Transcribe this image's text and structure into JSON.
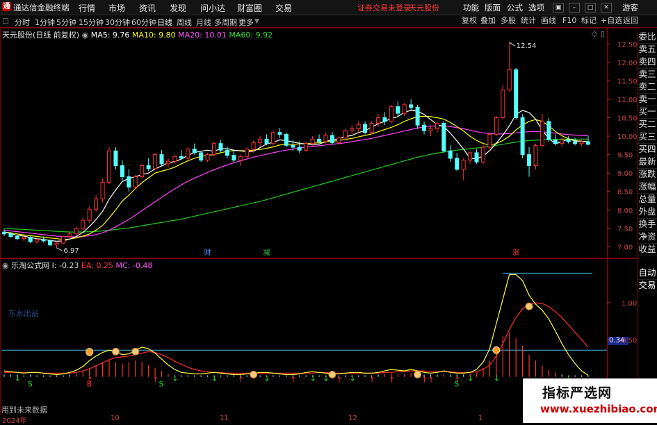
{
  "titlebar": {
    "app_title": "通达信金融终端",
    "menus": [
      "行情",
      "市场",
      "资讯",
      "发现",
      "问小达",
      "财富圈",
      "交易"
    ],
    "status_text": "证券交易未登录",
    "stock_name": "天元股份",
    "right_menus": [
      "功能",
      "版面",
      "公式",
      "选项"
    ],
    "guest": "游客"
  },
  "toolbar": {
    "periods": [
      "分时",
      "1分钟",
      "5分钟",
      "15分钟",
      "30分钟",
      "60分钟",
      "日线",
      "周线",
      "月线",
      "多周期",
      "更多"
    ],
    "active_period": "日线",
    "buttons": [
      "复权",
      "叠加",
      "多股",
      "统计",
      "画线",
      "F10",
      "标记",
      "+自选",
      "返回"
    ]
  },
  "main_chart": {
    "title": "天元股份(日线 前复权)",
    "ma_legend": [
      {
        "label": "MA5: 9.76",
        "color": "#ffffff"
      },
      {
        "label": "MA10: 9.80",
        "color": "#ffff00"
      },
      {
        "label": "MA20: 10.01",
        "color": "#ff55ff"
      },
      {
        "label": "MA60: 9.92",
        "color": "#33dd33"
      }
    ],
    "high_label": "12.54",
    "low_label": "6.97",
    "markers": [
      {
        "text": "财",
        "color": "#4a8cff"
      },
      {
        "text": "减",
        "color": "#33cc33"
      },
      {
        "text": "涨",
        "color": "#ff3333"
      }
    ]
  },
  "indicator": {
    "title": "乐淘公式网",
    "values": [
      {
        "label": "I: -0.23",
        "color": "#dddddd"
      },
      {
        "label": "EA: 0.25",
        "color": "#ff3333"
      },
      {
        "label": "MC: -0.48",
        "color": "#ff55ff"
      }
    ],
    "watermark_text": "东水出品",
    "current_value": "0.34",
    "footer_note": "用到未来数据",
    "signal_letters": [
      "S",
      "B",
      "S",
      "S"
    ]
  },
  "xaxis": {
    "labels": [
      "2024年",
      "10",
      "11",
      "12",
      "1"
    ]
  },
  "right_panel": {
    "items": [
      "委比",
      "卖五",
      "卖四",
      "卖三",
      "卖二",
      "卖一",
      "买一",
      "买二",
      "买三",
      "买四",
      "最新",
      "涨跌",
      "涨幅",
      "总量",
      "外盘",
      "换手",
      "净资",
      "收益"
    ],
    "bottom_items": [
      "自动",
      "交易"
    ]
  },
  "watermark": {
    "title": "指标严选网",
    "url": "www.xuezhibiao.com"
  },
  "chart_data": {
    "type": "candlestick",
    "ylabels": [
      "12.50",
      "12.00",
      "11.50",
      "11.00",
      "10.50",
      "10.00",
      "9.50",
      "9.00",
      "8.50",
      "8.00",
      "7.50",
      "7.00"
    ],
    "ylim": [
      6.8,
      12.6
    ],
    "indicator_ylabels": [
      "1.00",
      "0.50"
    ],
    "indicator_ylim": [
      -0.05,
      1.45
    ],
    "candles": [
      [
        7.4,
        7.48,
        7.3,
        7.35
      ],
      [
        7.35,
        7.4,
        7.25,
        7.28
      ],
      [
        7.28,
        7.32,
        7.18,
        7.22
      ],
      [
        7.22,
        7.3,
        7.15,
        7.26
      ],
      [
        7.26,
        7.3,
        7.1,
        7.14
      ],
      [
        7.14,
        7.25,
        7.08,
        7.2
      ],
      [
        7.2,
        7.28,
        7.12,
        7.16
      ],
      [
        7.16,
        7.2,
        7.02,
        7.05
      ],
      [
        7.05,
        7.15,
        6.97,
        7.1
      ],
      [
        7.1,
        7.3,
        7.08,
        7.28
      ],
      [
        7.28,
        7.42,
        7.22,
        7.35
      ],
      [
        7.35,
        7.55,
        7.3,
        7.5
      ],
      [
        7.5,
        7.8,
        7.45,
        7.72
      ],
      [
        7.72,
        8.1,
        7.65,
        8.02
      ],
      [
        8.02,
        8.4,
        7.95,
        8.3
      ],
      [
        8.3,
        8.85,
        8.2,
        8.75
      ],
      [
        8.75,
        9.7,
        8.7,
        9.6
      ],
      [
        9.6,
        9.7,
        9.1,
        9.2
      ],
      [
        9.2,
        9.35,
        8.8,
        8.9
      ],
      [
        8.9,
        9.1,
        8.5,
        8.62
      ],
      [
        8.62,
        8.95,
        8.55,
        8.9
      ],
      [
        8.9,
        9.25,
        8.85,
        9.2
      ],
      [
        9.2,
        9.4,
        9.05,
        9.12
      ],
      [
        9.12,
        9.55,
        9.1,
        9.5
      ],
      [
        9.5,
        9.62,
        9.2,
        9.25
      ],
      [
        9.25,
        9.4,
        9.15,
        9.32
      ],
      [
        9.32,
        9.5,
        9.25,
        9.45
      ],
      [
        9.45,
        9.62,
        9.35,
        9.4
      ],
      [
        9.4,
        9.7,
        9.35,
        9.65
      ],
      [
        9.65,
        9.8,
        9.5,
        9.55
      ],
      [
        9.55,
        9.6,
        9.3,
        9.35
      ],
      [
        9.35,
        9.55,
        9.3,
        9.5
      ],
      [
        9.5,
        9.85,
        9.45,
        9.8
      ],
      [
        9.8,
        9.9,
        9.55,
        9.62
      ],
      [
        9.62,
        9.72,
        9.4,
        9.48
      ],
      [
        9.48,
        9.6,
        9.3,
        9.35
      ],
      [
        9.35,
        9.5,
        9.2,
        9.45
      ],
      [
        9.45,
        9.7,
        9.4,
        9.65
      ],
      [
        9.65,
        9.88,
        9.55,
        9.82
      ],
      [
        9.82,
        10.0,
        9.7,
        9.92
      ],
      [
        9.92,
        10.05,
        9.75,
        9.8
      ],
      [
        9.8,
        10.15,
        9.75,
        10.1
      ],
      [
        10.1,
        10.22,
        9.95,
        10.05
      ],
      [
        10.05,
        10.1,
        9.7,
        9.75
      ],
      [
        9.75,
        9.9,
        9.6,
        9.7
      ],
      [
        9.7,
        9.85,
        9.55,
        9.62
      ],
      [
        9.62,
        9.85,
        9.58,
        9.8
      ],
      [
        9.8,
        10.0,
        9.72,
        9.92
      ],
      [
        9.92,
        10.05,
        9.8,
        9.85
      ],
      [
        9.85,
        10.1,
        9.8,
        10.02
      ],
      [
        10.02,
        10.12,
        9.78,
        9.82
      ],
      [
        9.82,
        10.0,
        9.78,
        9.95
      ],
      [
        9.95,
        10.2,
        9.9,
        10.15
      ],
      [
        10.15,
        10.3,
        10.05,
        10.2
      ],
      [
        10.2,
        10.4,
        10.1,
        10.32
      ],
      [
        10.32,
        10.4,
        10.05,
        10.1
      ],
      [
        10.1,
        10.4,
        10.05,
        10.35
      ],
      [
        10.35,
        10.6,
        10.25,
        10.5
      ],
      [
        10.5,
        10.65,
        10.3,
        10.4
      ],
      [
        10.4,
        10.85,
        10.35,
        10.8
      ],
      [
        10.8,
        10.95,
        10.55,
        10.62
      ],
      [
        10.62,
        10.9,
        10.55,
        10.85
      ],
      [
        10.85,
        11.0,
        10.7,
        10.78
      ],
      [
        10.78,
        10.85,
        10.2,
        10.3
      ],
      [
        10.3,
        10.4,
        10.05,
        10.15
      ],
      [
        10.15,
        10.3,
        10.0,
        10.2
      ],
      [
        10.2,
        10.4,
        10.1,
        10.35
      ],
      [
        10.35,
        10.4,
        9.55,
        9.6
      ],
      [
        9.6,
        9.75,
        9.3,
        9.4
      ],
      [
        9.4,
        9.55,
        9.05,
        9.1
      ],
      [
        9.1,
        9.4,
        8.8,
        9.35
      ],
      [
        9.35,
        9.6,
        9.25,
        9.55
      ],
      [
        9.55,
        9.65,
        9.25,
        9.3
      ],
      [
        9.3,
        9.75,
        9.25,
        9.7
      ],
      [
        9.7,
        10.1,
        9.65,
        10.05
      ],
      [
        10.05,
        10.55,
        10.0,
        10.5
      ],
      [
        10.5,
        11.4,
        10.45,
        11.25
      ],
      [
        11.25,
        12.54,
        11.2,
        11.8
      ],
      [
        11.8,
        11.85,
        10.45,
        10.5
      ],
      [
        10.5,
        10.6,
        9.4,
        9.5
      ],
      [
        9.5,
        9.7,
        8.9,
        9.2
      ],
      [
        9.2,
        9.8,
        9.1,
        9.75
      ],
      [
        9.75,
        10.6,
        9.7,
        10.4
      ],
      [
        10.4,
        10.5,
        9.85,
        9.9
      ],
      [
        9.9,
        10.05,
        9.75,
        9.8
      ],
      [
        9.8,
        9.95,
        9.7,
        9.9
      ],
      [
        9.9,
        10.0,
        9.8,
        9.85
      ],
      [
        9.85,
        9.95,
        9.75,
        9.8
      ],
      [
        9.8,
        9.92,
        9.72,
        9.85
      ],
      [
        9.85,
        10.0,
        9.75,
        9.78
      ]
    ],
    "ma5": [
      7.4,
      7.36,
      7.31,
      7.29,
      7.25,
      7.22,
      7.2,
      7.17,
      7.15,
      7.16,
      7.21,
      7.28,
      7.39,
      7.55,
      7.74,
      7.96,
      8.29,
      8.54,
      8.77,
      8.85,
      8.9,
      8.96,
      9.0,
      9.11,
      9.19,
      9.28,
      9.31,
      9.38,
      9.48,
      9.56,
      9.59,
      9.62,
      9.59,
      9.66,
      9.66,
      9.62,
      9.6,
      9.58,
      9.59,
      9.69,
      9.79,
      9.83,
      9.9,
      9.88,
      9.84,
      9.81,
      9.78,
      9.77,
      9.78,
      9.86,
      9.9,
      9.93,
      9.99,
      10.02,
      10.1,
      10.15,
      10.24,
      10.34,
      10.4,
      10.48,
      10.53,
      10.65,
      10.7,
      10.68,
      10.59,
      10.45,
      10.31,
      10.26,
      10.08,
      9.87,
      9.65,
      9.4,
      9.39,
      9.46,
      9.61,
      9.81,
      10.03,
      10.28,
      10.59,
      10.7,
      10.64,
      10.46,
      10.16,
      9.94,
      9.79,
      9.85,
      9.92,
      9.87,
      9.86,
      9.84
    ],
    "ma10": [
      7.4,
      7.38,
      7.35,
      7.32,
      7.3,
      7.28,
      7.26,
      7.24,
      7.22,
      7.2,
      7.21,
      7.24,
      7.29,
      7.35,
      7.45,
      7.58,
      7.78,
      8.0,
      8.24,
      8.4,
      8.58,
      8.74,
      8.87,
      9.0,
      9.05,
      9.1,
      9.16,
      9.25,
      9.33,
      9.4,
      9.45,
      9.48,
      9.5,
      9.55,
      9.59,
      9.61,
      9.61,
      9.6,
      9.62,
      9.64,
      9.67,
      9.71,
      9.76,
      9.78,
      9.78,
      9.79,
      9.8,
      9.81,
      9.82,
      9.84,
      9.86,
      9.88,
      9.91,
      9.94,
      9.98,
      10.02,
      10.06,
      10.12,
      10.18,
      10.24,
      10.31,
      10.4,
      10.47,
      10.53,
      10.54,
      10.53,
      10.5,
      10.46,
      10.37,
      10.26,
      10.14,
      10.0,
      9.88,
      9.8,
      9.76,
      9.8,
      9.88,
      10.0,
      10.17,
      10.3,
      10.4,
      10.45,
      10.4,
      10.28,
      10.13,
      10.01,
      9.93,
      9.88,
      9.86,
      9.85
    ],
    "ma20": [
      7.45,
      7.43,
      7.41,
      7.39,
      7.37,
      7.35,
      7.33,
      7.31,
      7.29,
      7.28,
      7.27,
      7.27,
      7.28,
      7.3,
      7.33,
      7.38,
      7.45,
      7.54,
      7.64,
      7.74,
      7.86,
      7.98,
      8.1,
      8.22,
      8.34,
      8.46,
      8.57,
      8.68,
      8.78,
      8.86,
      8.94,
      9.02,
      9.09,
      9.16,
      9.22,
      9.28,
      9.33,
      9.38,
      9.43,
      9.47,
      9.51,
      9.55,
      9.59,
      9.62,
      9.65,
      9.68,
      9.7,
      9.72,
      9.74,
      9.76,
      9.78,
      9.8,
      9.82,
      9.85,
      9.88,
      9.91,
      9.94,
      9.98,
      10.02,
      10.06,
      10.1,
      10.14,
      10.18,
      10.22,
      10.25,
      10.27,
      10.28,
      10.28,
      10.26,
      10.23,
      10.2,
      10.16,
      10.12,
      10.09,
      10.07,
      10.06,
      10.06,
      10.07,
      10.09,
      10.11,
      10.12,
      10.13,
      10.12,
      10.1,
      10.08,
      10.06,
      10.04,
      10.03,
      10.02,
      10.01
    ],
    "ma60": [
      7.5,
      7.49,
      7.48,
      7.47,
      7.46,
      7.45,
      7.44,
      7.43,
      7.42,
      7.41,
      7.4,
      7.4,
      7.4,
      7.41,
      7.42,
      7.43,
      7.45,
      7.47,
      7.49,
      7.51,
      7.54,
      7.57,
      7.6,
      7.63,
      7.66,
      7.69,
      7.72,
      7.75,
      7.79,
      7.83,
      7.87,
      7.91,
      7.95,
      7.99,
      8.03,
      8.07,
      8.11,
      8.15,
      8.19,
      8.23,
      8.28,
      8.33,
      8.38,
      8.43,
      8.48,
      8.53,
      8.58,
      8.63,
      8.68,
      8.73,
      8.78,
      8.83,
      8.88,
      8.93,
      8.98,
      9.03,
      9.08,
      9.13,
      9.18,
      9.23,
      9.28,
      9.33,
      9.38,
      9.43,
      9.47,
      9.51,
      9.54,
      9.57,
      9.6,
      9.62,
      9.64,
      9.66,
      9.68,
      9.7,
      9.72,
      9.75,
      9.78,
      9.81,
      9.84,
      9.86,
      9.88,
      9.89,
      9.9,
      9.91,
      9.91,
      9.92,
      9.92,
      9.92,
      9.92,
      9.92
    ],
    "ind_i": [
      0.08,
      0.07,
      0.06,
      0.05,
      0.06,
      0.06,
      0.05,
      0.04,
      0.03,
      0.04,
      0.06,
      0.09,
      0.14,
      0.22,
      0.28,
      0.33,
      0.36,
      0.34,
      0.3,
      0.31,
      0.36,
      0.4,
      0.38,
      0.32,
      0.24,
      0.16,
      0.1,
      0.06,
      0.05,
      0.04,
      0.04,
      0.05,
      0.06,
      0.05,
      0.04,
      0.03,
      0.03,
      0.04,
      0.05,
      0.06,
      0.06,
      0.05,
      0.04,
      0.03,
      0.03,
      0.04,
      0.06,
      0.07,
      0.06,
      0.05,
      0.04,
      0.04,
      0.05,
      0.06,
      0.06,
      0.05,
      0.05,
      0.06,
      0.08,
      0.1,
      0.09,
      0.08,
      0.1,
      0.08,
      0.06,
      0.05,
      0.06,
      0.08,
      0.06,
      0.05,
      0.05,
      0.06,
      0.1,
      0.2,
      0.38,
      0.72,
      1.05,
      1.38,
      1.38,
      1.3,
      1.1,
      0.98,
      0.9,
      0.78,
      0.62,
      0.45,
      0.3,
      0.18,
      0.08,
      0.02
    ],
    "ind_ea": [
      0.06,
      0.06,
      0.06,
      0.06,
      0.06,
      0.06,
      0.05,
      0.05,
      0.05,
      0.05,
      0.05,
      0.06,
      0.08,
      0.11,
      0.15,
      0.19,
      0.23,
      0.26,
      0.27,
      0.28,
      0.3,
      0.32,
      0.34,
      0.33,
      0.3,
      0.26,
      0.21,
      0.17,
      0.13,
      0.1,
      0.08,
      0.07,
      0.06,
      0.06,
      0.05,
      0.05,
      0.05,
      0.05,
      0.05,
      0.05,
      0.05,
      0.05,
      0.05,
      0.05,
      0.05,
      0.05,
      0.05,
      0.05,
      0.06,
      0.06,
      0.05,
      0.05,
      0.05,
      0.05,
      0.05,
      0.05,
      0.05,
      0.05,
      0.06,
      0.06,
      0.07,
      0.07,
      0.08,
      0.08,
      0.08,
      0.07,
      0.07,
      0.07,
      0.07,
      0.06,
      0.06,
      0.06,
      0.07,
      0.1,
      0.16,
      0.28,
      0.45,
      0.64,
      0.8,
      0.92,
      0.98,
      1.0,
      0.99,
      0.95,
      0.88,
      0.8,
      0.7,
      0.6,
      0.5,
      0.4
    ],
    "ind_bars": [
      0.03,
      0.03,
      0.03,
      0.02,
      0.03,
      0.02,
      0.02,
      0.02,
      0.02,
      0.02,
      0.03,
      0.05,
      0.08,
      0.12,
      0.16,
      0.2,
      0.22,
      0.2,
      0.18,
      0.2,
      0.22,
      0.2,
      0.16,
      0.12,
      0.08,
      0.04,
      0.02,
      0.02,
      0.02,
      0.02,
      0.02,
      0.02,
      0.02,
      0.02,
      0.02,
      0.02,
      0.02,
      0.02,
      0.02,
      0.02,
      0.02,
      0.02,
      0.02,
      0.02,
      0.02,
      0.02,
      0.02,
      0.02,
      0.02,
      0.02,
      0.02,
      0.02,
      0.02,
      0.02,
      0.02,
      0.02,
      0.02,
      0.03,
      0.04,
      0.05,
      0.04,
      0.04,
      0.05,
      0.04,
      0.03,
      0.03,
      0.03,
      0.04,
      0.03,
      0.03,
      0.03,
      0.04,
      0.06,
      0.12,
      0.22,
      0.4,
      0.55,
      0.6,
      0.52,
      0.42,
      0.3,
      0.22,
      0.15,
      0.1,
      0.06,
      0.03,
      0.02,
      0.02,
      0.02,
      0.02
    ],
    "ind_hlines": [
      0.36,
      1.4
    ]
  }
}
